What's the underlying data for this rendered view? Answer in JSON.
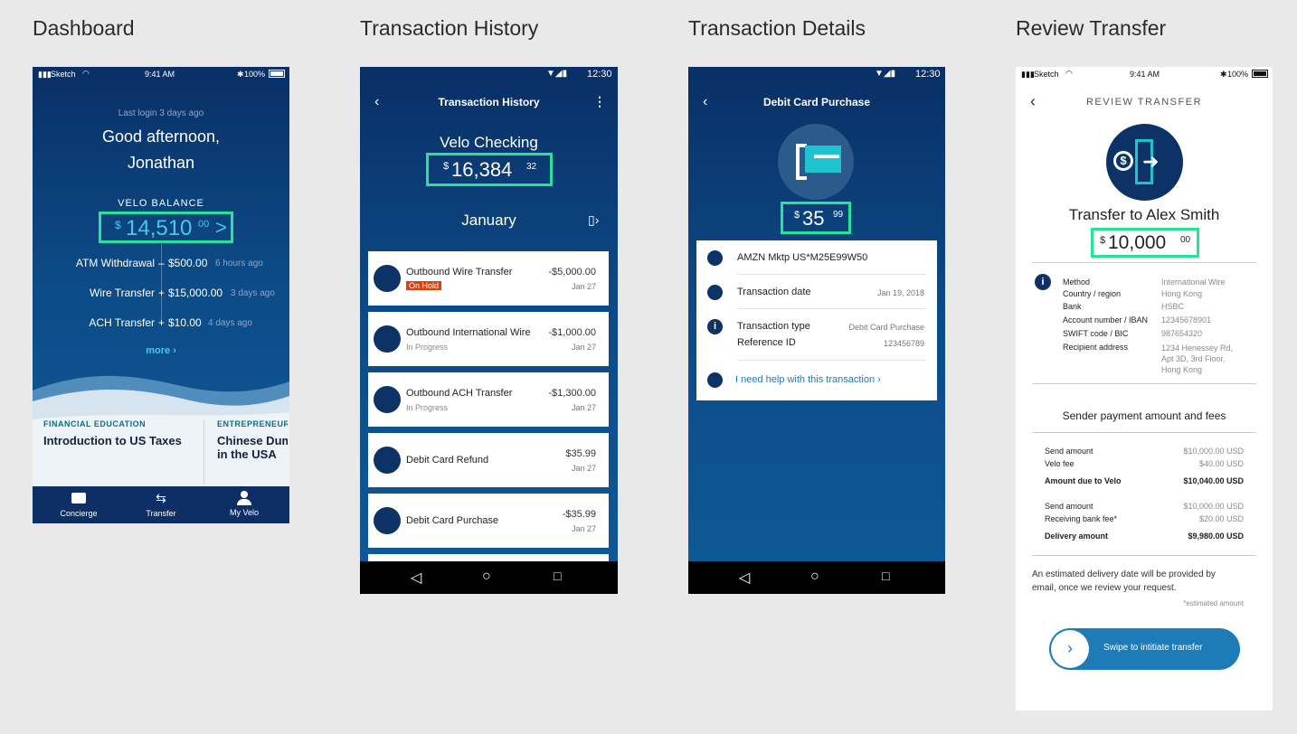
{
  "titles": [
    "Dashboard",
    "Transaction History",
    "Transaction Details",
    "Review Transfer"
  ],
  "ios_status": {
    "carrier": "Sketch",
    "time": "9:41 AM",
    "battery": "100%"
  },
  "android_status": {
    "time": "12:30"
  },
  "dashboard": {
    "last_login": "Last login 3 days ago",
    "greeting_line1": "Good afternoon,",
    "greeting_line2": "Jonathan",
    "balance_label": "VELO BALANCE",
    "balance": {
      "currency": "$",
      "whole": "14,510",
      "cents": "00",
      "arrow": ">"
    },
    "activity": [
      {
        "label": "ATM Withdrawal",
        "sign": "–",
        "amount": "$500.00",
        "when": "6 hours ago"
      },
      {
        "label": "Wire Transfer",
        "sign": "+",
        "amount": "$15,000.00",
        "when": "3 days ago"
      },
      {
        "label": "ACH Transfer",
        "sign": "+",
        "amount": "$10.00",
        "when": "4 days ago"
      }
    ],
    "more": "more ›",
    "cards": [
      {
        "category": "FINANCIAL EDUCATION",
        "title": "Introduction to US Taxes"
      },
      {
        "category": "ENTREPRENEURS",
        "title": "Chinese Dum in the USA"
      }
    ],
    "tabs": [
      {
        "label": "Concierge"
      },
      {
        "label": "Transfer"
      },
      {
        "label": "My Velo"
      }
    ]
  },
  "history": {
    "title": "Transaction History",
    "account": "Velo Checking",
    "balance": {
      "currency": "$",
      "whole": "16,384",
      "cents": "32"
    },
    "month": "January",
    "transactions": [
      {
        "name": "Outbound Wire Transfer",
        "status": "On Hold",
        "amount": "-$5,000.00",
        "date": "Jan 27"
      },
      {
        "name": "Outbound International Wire",
        "status": "In Progress",
        "amount": "-$1,000.00",
        "date": "Jan 27"
      },
      {
        "name": "Outbound ACH Transfer",
        "status": "In Progress",
        "amount": "-$1,300.00",
        "date": "Jan 27"
      },
      {
        "name": "Debit Card Refund",
        "status": "",
        "amount": "$35.99",
        "date": "Jan 27"
      },
      {
        "name": "Debit Card Purchase",
        "status": "",
        "amount": "-$35.99",
        "date": "Jan 27"
      }
    ]
  },
  "details": {
    "title": "Debit Card Purchase",
    "amount": {
      "currency": "$",
      "whole": "35",
      "cents": "99"
    },
    "merchant": "AMZN Mktp US*M25E99W50",
    "date_label": "Transaction date",
    "date_value": "Jan 19, 2018",
    "type_label": "Transaction type",
    "type_value": "Debit Card Purchase",
    "ref_label": "Reference ID",
    "ref_value": "123456789",
    "help": "I need help with this transaction ›"
  },
  "review": {
    "title": "REVIEW TRANSFER",
    "recipient": "Transfer to Alex Smith",
    "amount": {
      "currency": "$",
      "whole": "10,000",
      "cents": "00"
    },
    "fields": [
      {
        "label": "Method",
        "value": "International Wire"
      },
      {
        "label": "Country / region",
        "value": "Hong Kong"
      },
      {
        "label": "Bank",
        "value": "HSBC"
      },
      {
        "label": "Account number / IBAN",
        "value": "12345678901"
      },
      {
        "label": "SWIFT code / BIC",
        "value": "987654320"
      },
      {
        "label": "Recipient address",
        "value": "1234 Henessey Rd, Apt 3D, 3rd Floor, Hong Kong"
      }
    ],
    "fees_title": "Sender payment amount and fees",
    "fees1": [
      {
        "label": "Send amount",
        "value": "$10,000.00 USD"
      },
      {
        "label": "Velo fee",
        "value": "$40.00 USD"
      },
      {
        "label": "Amount due to Velo",
        "value": "$10,040.00 USD"
      }
    ],
    "fees2": [
      {
        "label": "Send amount",
        "value": "$10,000.00 USD"
      },
      {
        "label": "Receiving bank fee*",
        "value": "$20.00 USD"
      },
      {
        "label": "Delivery amount",
        "value": "$9,980.00 USD"
      }
    ],
    "note": "An estimated delivery date will be provided by email, once we review your request.",
    "footnote": "*estimated amount",
    "swipe": "Swipe to intitiate transfer"
  }
}
